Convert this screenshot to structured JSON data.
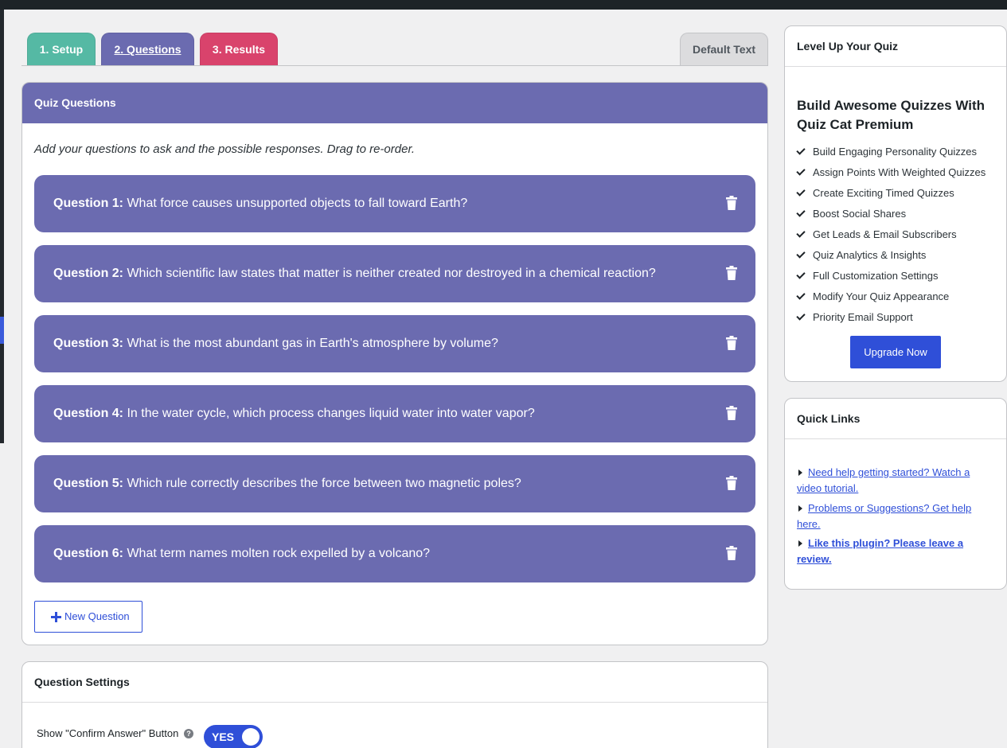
{
  "tabs": {
    "setup": "1. Setup",
    "questions": "2. Questions",
    "results": "3. Results",
    "default_text": "Default Text"
  },
  "quiz_questions": {
    "header": "Quiz Questions",
    "intro": "Add your questions to ask and the possible responses. Drag to re-order.",
    "questions": [
      {
        "num": "Question 1:",
        "text": "What force causes unsupported objects to fall toward Earth?"
      },
      {
        "num": "Question 2:",
        "text": "Which scientific law states that matter is neither created nor destroyed in a chemical reaction?"
      },
      {
        "num": "Question 3:",
        "text": "What is the most abundant gas in Earth's atmosphere by volume?"
      },
      {
        "num": "Question 4:",
        "text": "In the water cycle, which process changes liquid water into water vapor?"
      },
      {
        "num": "Question 5:",
        "text": "Which rule correctly describes the force between two magnetic poles?"
      },
      {
        "num": "Question 6:",
        "text": "What term names molten rock expelled by a volcano?"
      }
    ],
    "new_question_label": "New Question"
  },
  "question_settings": {
    "header": "Question Settings",
    "confirm_label": "Show \"Confirm Answer\" Button",
    "help_glyph": "?",
    "toggle_label": "YES"
  },
  "level_up": {
    "header": "Level Up Your Quiz",
    "title": "Build Awesome Quizzes With Quiz Cat Premium",
    "features": [
      "Build Engaging Personality Quizzes",
      "Assign Points With Weighted Quizzes",
      "Create Exciting Timed Quizzes",
      "Boost Social Shares",
      "Get Leads & Email Subscribers",
      "Quiz Analytics & Insights",
      "Full Customization Settings",
      "Modify Your Quiz Appearance",
      "Priority Email Support"
    ],
    "upgrade_label": "Upgrade Now"
  },
  "quick_links": {
    "header": "Quick Links",
    "links": [
      "Need help getting started? Watch a video tutorial.",
      "Problems or Suggestions? Get help here.",
      "Like this plugin? Please leave a review."
    ]
  },
  "colors": {
    "tab_setup": "#55b9a4",
    "tab_questions": "#6b6bb0",
    "tab_results": "#d9436c",
    "accent": "#2f4fd8",
    "question_card": "#6b6bb0"
  },
  "icons": [
    "trash-icon",
    "plus-icon",
    "help-icon",
    "check-icon",
    "triangle-right-icon"
  ]
}
